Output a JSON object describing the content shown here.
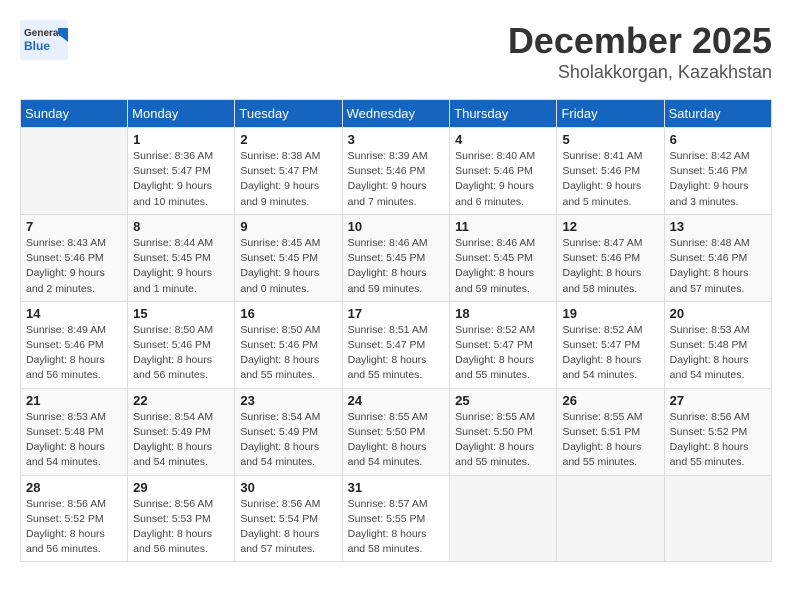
{
  "header": {
    "logo_top": "General",
    "logo_bottom": "Blue",
    "month": "December 2025",
    "location": "Sholakkorgan, Kazakhstan"
  },
  "weekdays": [
    "Sunday",
    "Monday",
    "Tuesday",
    "Wednesday",
    "Thursday",
    "Friday",
    "Saturday"
  ],
  "weeks": [
    [
      {
        "day": "",
        "detail": ""
      },
      {
        "day": "1",
        "detail": "Sunrise: 8:36 AM\nSunset: 5:47 PM\nDaylight: 9 hours\nand 10 minutes."
      },
      {
        "day": "2",
        "detail": "Sunrise: 8:38 AM\nSunset: 5:47 PM\nDaylight: 9 hours\nand 9 minutes."
      },
      {
        "day": "3",
        "detail": "Sunrise: 8:39 AM\nSunset: 5:46 PM\nDaylight: 9 hours\nand 7 minutes."
      },
      {
        "day": "4",
        "detail": "Sunrise: 8:40 AM\nSunset: 5:46 PM\nDaylight: 9 hours\nand 6 minutes."
      },
      {
        "day": "5",
        "detail": "Sunrise: 8:41 AM\nSunset: 5:46 PM\nDaylight: 9 hours\nand 5 minutes."
      },
      {
        "day": "6",
        "detail": "Sunrise: 8:42 AM\nSunset: 5:46 PM\nDaylight: 9 hours\nand 3 minutes."
      }
    ],
    [
      {
        "day": "7",
        "detail": "Sunrise: 8:43 AM\nSunset: 5:46 PM\nDaylight: 9 hours\nand 2 minutes."
      },
      {
        "day": "8",
        "detail": "Sunrise: 8:44 AM\nSunset: 5:45 PM\nDaylight: 9 hours\nand 1 minute."
      },
      {
        "day": "9",
        "detail": "Sunrise: 8:45 AM\nSunset: 5:45 PM\nDaylight: 9 hours\nand 0 minutes."
      },
      {
        "day": "10",
        "detail": "Sunrise: 8:46 AM\nSunset: 5:45 PM\nDaylight: 8 hours\nand 59 minutes."
      },
      {
        "day": "11",
        "detail": "Sunrise: 8:46 AM\nSunset: 5:45 PM\nDaylight: 8 hours\nand 59 minutes."
      },
      {
        "day": "12",
        "detail": "Sunrise: 8:47 AM\nSunset: 5:46 PM\nDaylight: 8 hours\nand 58 minutes."
      },
      {
        "day": "13",
        "detail": "Sunrise: 8:48 AM\nSunset: 5:46 PM\nDaylight: 8 hours\nand 57 minutes."
      }
    ],
    [
      {
        "day": "14",
        "detail": "Sunrise: 8:49 AM\nSunset: 5:46 PM\nDaylight: 8 hours\nand 56 minutes."
      },
      {
        "day": "15",
        "detail": "Sunrise: 8:50 AM\nSunset: 5:46 PM\nDaylight: 8 hours\nand 56 minutes."
      },
      {
        "day": "16",
        "detail": "Sunrise: 8:50 AM\nSunset: 5:46 PM\nDaylight: 8 hours\nand 55 minutes."
      },
      {
        "day": "17",
        "detail": "Sunrise: 8:51 AM\nSunset: 5:47 PM\nDaylight: 8 hours\nand 55 minutes."
      },
      {
        "day": "18",
        "detail": "Sunrise: 8:52 AM\nSunset: 5:47 PM\nDaylight: 8 hours\nand 55 minutes."
      },
      {
        "day": "19",
        "detail": "Sunrise: 8:52 AM\nSunset: 5:47 PM\nDaylight: 8 hours\nand 54 minutes."
      },
      {
        "day": "20",
        "detail": "Sunrise: 8:53 AM\nSunset: 5:48 PM\nDaylight: 8 hours\nand 54 minutes."
      }
    ],
    [
      {
        "day": "21",
        "detail": "Sunrise: 8:53 AM\nSunset: 5:48 PM\nDaylight: 8 hours\nand 54 minutes."
      },
      {
        "day": "22",
        "detail": "Sunrise: 8:54 AM\nSunset: 5:49 PM\nDaylight: 8 hours\nand 54 minutes."
      },
      {
        "day": "23",
        "detail": "Sunrise: 8:54 AM\nSunset: 5:49 PM\nDaylight: 8 hours\nand 54 minutes."
      },
      {
        "day": "24",
        "detail": "Sunrise: 8:55 AM\nSunset: 5:50 PM\nDaylight: 8 hours\nand 54 minutes."
      },
      {
        "day": "25",
        "detail": "Sunrise: 8:55 AM\nSunset: 5:50 PM\nDaylight: 8 hours\nand 55 minutes."
      },
      {
        "day": "26",
        "detail": "Sunrise: 8:55 AM\nSunset: 5:51 PM\nDaylight: 8 hours\nand 55 minutes."
      },
      {
        "day": "27",
        "detail": "Sunrise: 8:56 AM\nSunset: 5:52 PM\nDaylight: 8 hours\nand 55 minutes."
      }
    ],
    [
      {
        "day": "28",
        "detail": "Sunrise: 8:56 AM\nSunset: 5:52 PM\nDaylight: 8 hours\nand 56 minutes."
      },
      {
        "day": "29",
        "detail": "Sunrise: 8:56 AM\nSunset: 5:53 PM\nDaylight: 8 hours\nand 56 minutes."
      },
      {
        "day": "30",
        "detail": "Sunrise: 8:56 AM\nSunset: 5:54 PM\nDaylight: 8 hours\nand 57 minutes."
      },
      {
        "day": "31",
        "detail": "Sunrise: 8:57 AM\nSunset: 5:55 PM\nDaylight: 8 hours\nand 58 minutes."
      },
      {
        "day": "",
        "detail": ""
      },
      {
        "day": "",
        "detail": ""
      },
      {
        "day": "",
        "detail": ""
      }
    ]
  ]
}
